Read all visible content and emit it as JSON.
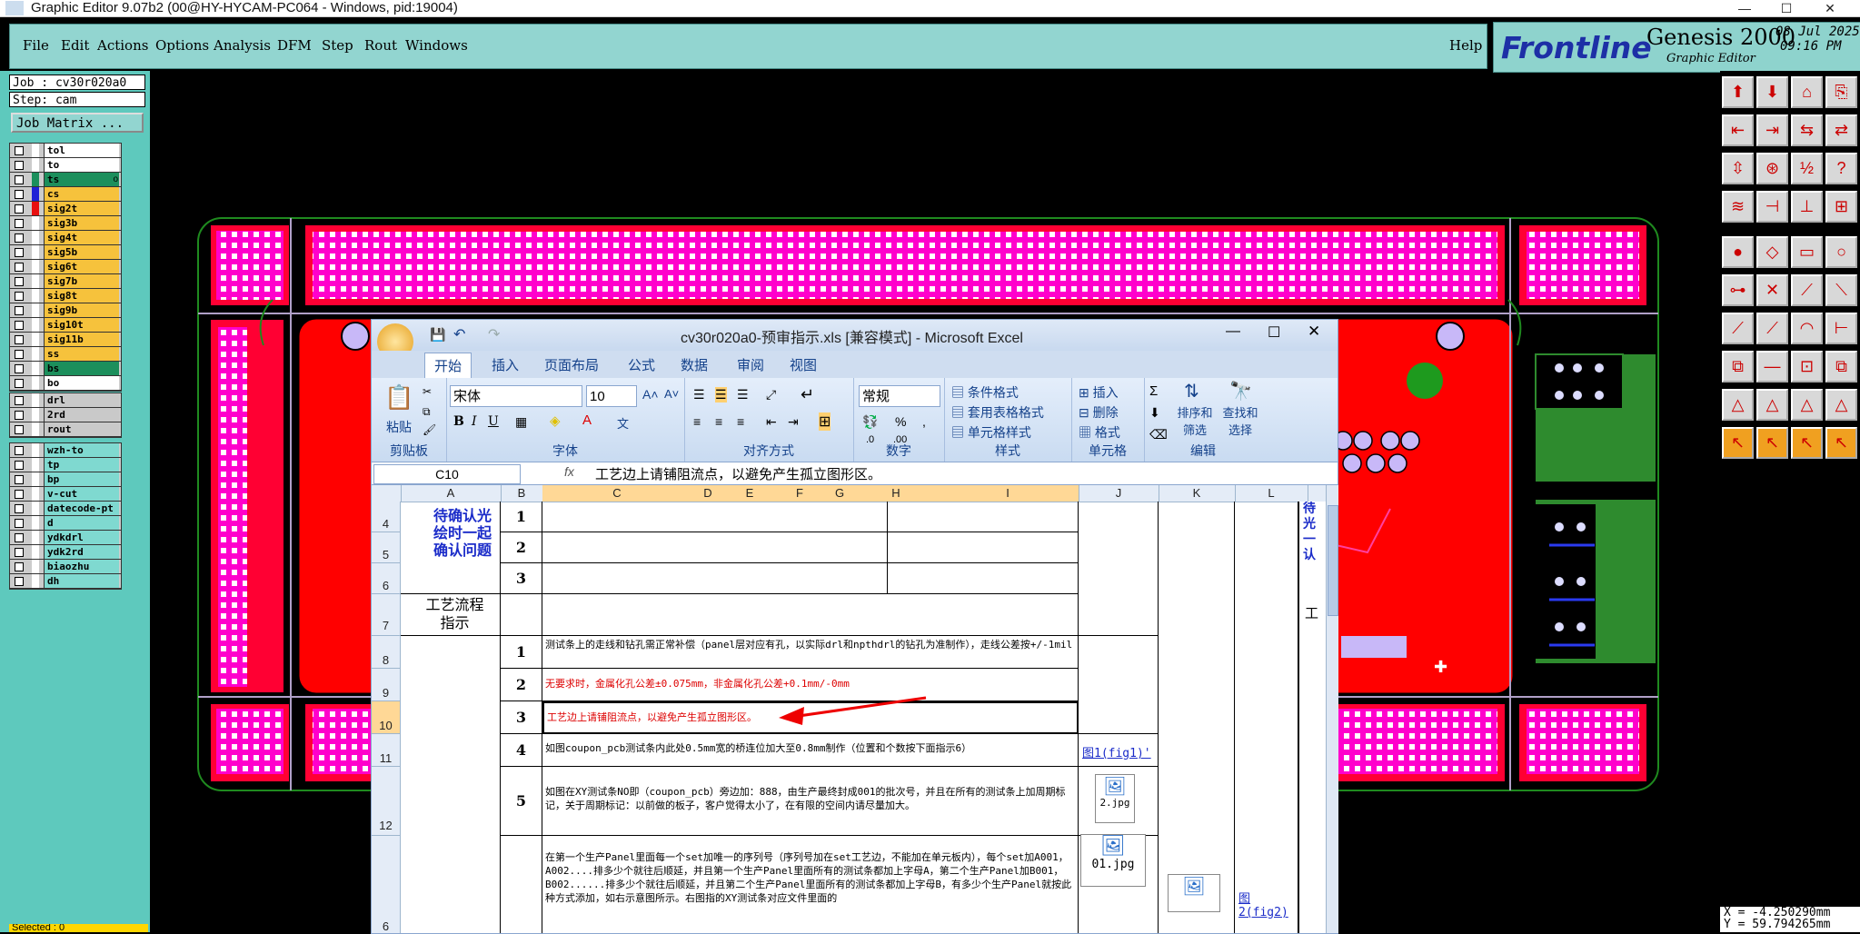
{
  "app": {
    "title": "Graphic Editor 9.07b2 (00@HY-HYCAM-PC064 - Windows, pid:19004)",
    "min": "—",
    "max": "☐",
    "close": "✕"
  },
  "menu": {
    "items": [
      "File",
      "Edit",
      "Actions",
      "Options",
      "Analysis",
      "DFM",
      "Step",
      "Rout",
      "Windows"
    ],
    "help": "Help"
  },
  "brand": {
    "frontline": "Frontline",
    "genesis": "Genesis 2000",
    "subtitle": "Graphic Editor",
    "date": "08 Jul 2025",
    "time": "09:16 PM"
  },
  "job": {
    "job": "Job : cv30r020a0",
    "step": "Step: cam",
    "matrix_button": "Job Matrix ..."
  },
  "layers_group1": [
    {
      "name": "tol",
      "color": "#ffffff",
      "bg": "#ffffff"
    },
    {
      "name": "to",
      "color": "#ffffff",
      "bg": "#ffffff"
    },
    {
      "name": "ts",
      "color": "#1c8f5c",
      "bg": "#1c8f5c",
      "extra": "o"
    },
    {
      "name": "cs",
      "color": "#1f22d6",
      "bg": "#f6c23c"
    },
    {
      "name": "sig2t",
      "color": "#e81010",
      "bg": "#f6c23c"
    },
    {
      "name": "sig3b",
      "color": "#ffffff",
      "bg": "#f6c23c"
    },
    {
      "name": "sig4t",
      "color": "#ffffff",
      "bg": "#f6c23c"
    },
    {
      "name": "sig5b",
      "color": "#ffffff",
      "bg": "#f6c23c"
    },
    {
      "name": "sig6t",
      "color": "#ffffff",
      "bg": "#f6c23c"
    },
    {
      "name": "sig7b",
      "color": "#ffffff",
      "bg": "#f6c23c"
    },
    {
      "name": "sig8t",
      "color": "#ffffff",
      "bg": "#f6c23c"
    },
    {
      "name": "sig9b",
      "color": "#ffffff",
      "bg": "#f6c23c"
    },
    {
      "name": "sig10t",
      "color": "#ffffff",
      "bg": "#f6c23c"
    },
    {
      "name": "sig11b",
      "color": "#ffffff",
      "bg": "#f6c23c"
    },
    {
      "name": "ss",
      "color": "#ffffff",
      "bg": "#f6c23c"
    },
    {
      "name": "bs",
      "color": "#ffffff",
      "bg": "#1c8f5c"
    },
    {
      "name": "bo",
      "color": "#ffffff",
      "bg": "#ffffff"
    }
  ],
  "layers_group2": [
    {
      "name": "drl",
      "color": "#ffffff",
      "bg": "#c9c9c9"
    },
    {
      "name": "2rd",
      "color": "#ffffff",
      "bg": "#c9c9c9"
    },
    {
      "name": "rout",
      "color": "#ffffff",
      "bg": "#c9c9c9"
    }
  ],
  "layers_group3": [
    {
      "name": "wzh-to",
      "color": "#ffffff",
      "bg": "#7fd9d0"
    },
    {
      "name": "tp",
      "color": "#ffffff",
      "bg": "#7fd9d0"
    },
    {
      "name": "bp",
      "color": "#ffffff",
      "bg": "#7fd9d0"
    },
    {
      "name": "v-cut",
      "color": "#ffffff",
      "bg": "#7fd9d0"
    },
    {
      "name": "datecode-pt",
      "color": "#ffffff",
      "bg": "#7fd9d0"
    },
    {
      "name": "d",
      "color": "#ffffff",
      "bg": "#7fd9d0"
    },
    {
      "name": "ydkdrl",
      "color": "#ffffff",
      "bg": "#7fd9d0"
    },
    {
      "name": "ydk2rd",
      "color": "#ffffff",
      "bg": "#7fd9d0"
    },
    {
      "name": "biaozhu",
      "color": "#ffffff",
      "bg": "#7fd9d0"
    },
    {
      "name": "dh",
      "color": "#ffffff",
      "bg": "#7fd9d0"
    }
  ],
  "selected": "Selected : 0",
  "coords": {
    "x": "X = -4.250290mm",
    "y": "Y = 59.794265mm"
  },
  "excel": {
    "title": "cv30r020a0-预审指示.xls  [兼容模式] - Microsoft Excel",
    "tabs": [
      "开始",
      "插入",
      "页面布局",
      "公式",
      "数据",
      "审阅",
      "视图"
    ],
    "paste": "粘贴",
    "font_name": "宋体",
    "font_size": "10",
    "number_format": "常规",
    "groups": [
      "剪贴板",
      "字体",
      "对齐方式",
      "数字",
      "样式",
      "单元格",
      "编辑"
    ],
    "styles": [
      "条件格式",
      "套用表格格式",
      "单元格样式"
    ],
    "cells": [
      "插入",
      "删除",
      "格式"
    ],
    "sort": "排序和\n筛选",
    "find": "查找和\n选择",
    "name_box": "C10",
    "fx": "fx",
    "formula": "工艺边上请铺阻流点，以避免产生孤立图形区。",
    "columns": [
      "A",
      "B",
      "C",
      "D",
      "E",
      "F",
      "G",
      "H",
      "I",
      "J",
      "K",
      "L"
    ],
    "rows": [
      "4",
      "5",
      "6",
      "7",
      "8",
      "9",
      "10",
      "11",
      "12",
      "6"
    ],
    "pending": "待确认光绘时一起确认问题",
    "pending_right": "待光一认",
    "process": "工艺流程指示",
    "process_right": "工",
    "r8": "测试条上的走线和钻孔需正常补偿（panel层对应有孔，以实际drl和npthdrl的钻孔为准制作），走线公差按+/-1mil",
    "r9": "无要求时，金属化孔公差±0.075mm，非金属化孔公差+0.1mm/-0mm",
    "r10": "工艺边上请铺阻流点，以避免产生孤立图形区。",
    "r11": "如图coupon_pcb测试条内此处0.5mm宽的桥连位加大至0.8mm制作（位置和个数按下面指示6）",
    "r11_link": "图1(fig1)'",
    "r12": "如图在XY测试条NO即（coupon_pcb）旁边加：888，由生产最终封成001的批次号，并且在所有的测试条上加周期标记，关于周期标记：以前做的板子，客户觉得太小了，在有限的空间内请尽量加大。",
    "r12_img": "2.jpg",
    "r13": "在第一个生产Panel里面每一个set加唯一的序列号（序列号加在set工艺边，不能加在单元板内），每个set加A001，A002....排多少个就往后顺延，并且第一个生产Panel里面所有的测试条都加上字母A，第二个生产Panel加B001，B002......排多少个就往后顺延，并且第二个生产Panel里面所有的测试条都加上字母B，有多少个生产Panel就按此种方式添加，如右示意图所示。右图指的XY测试条对应文件里面的",
    "r13_img": "01.jpg",
    "r13_link": "图2(fig2)",
    "nums": [
      "1",
      "2",
      "3",
      "1",
      "2",
      "3",
      "4",
      "5"
    ]
  }
}
